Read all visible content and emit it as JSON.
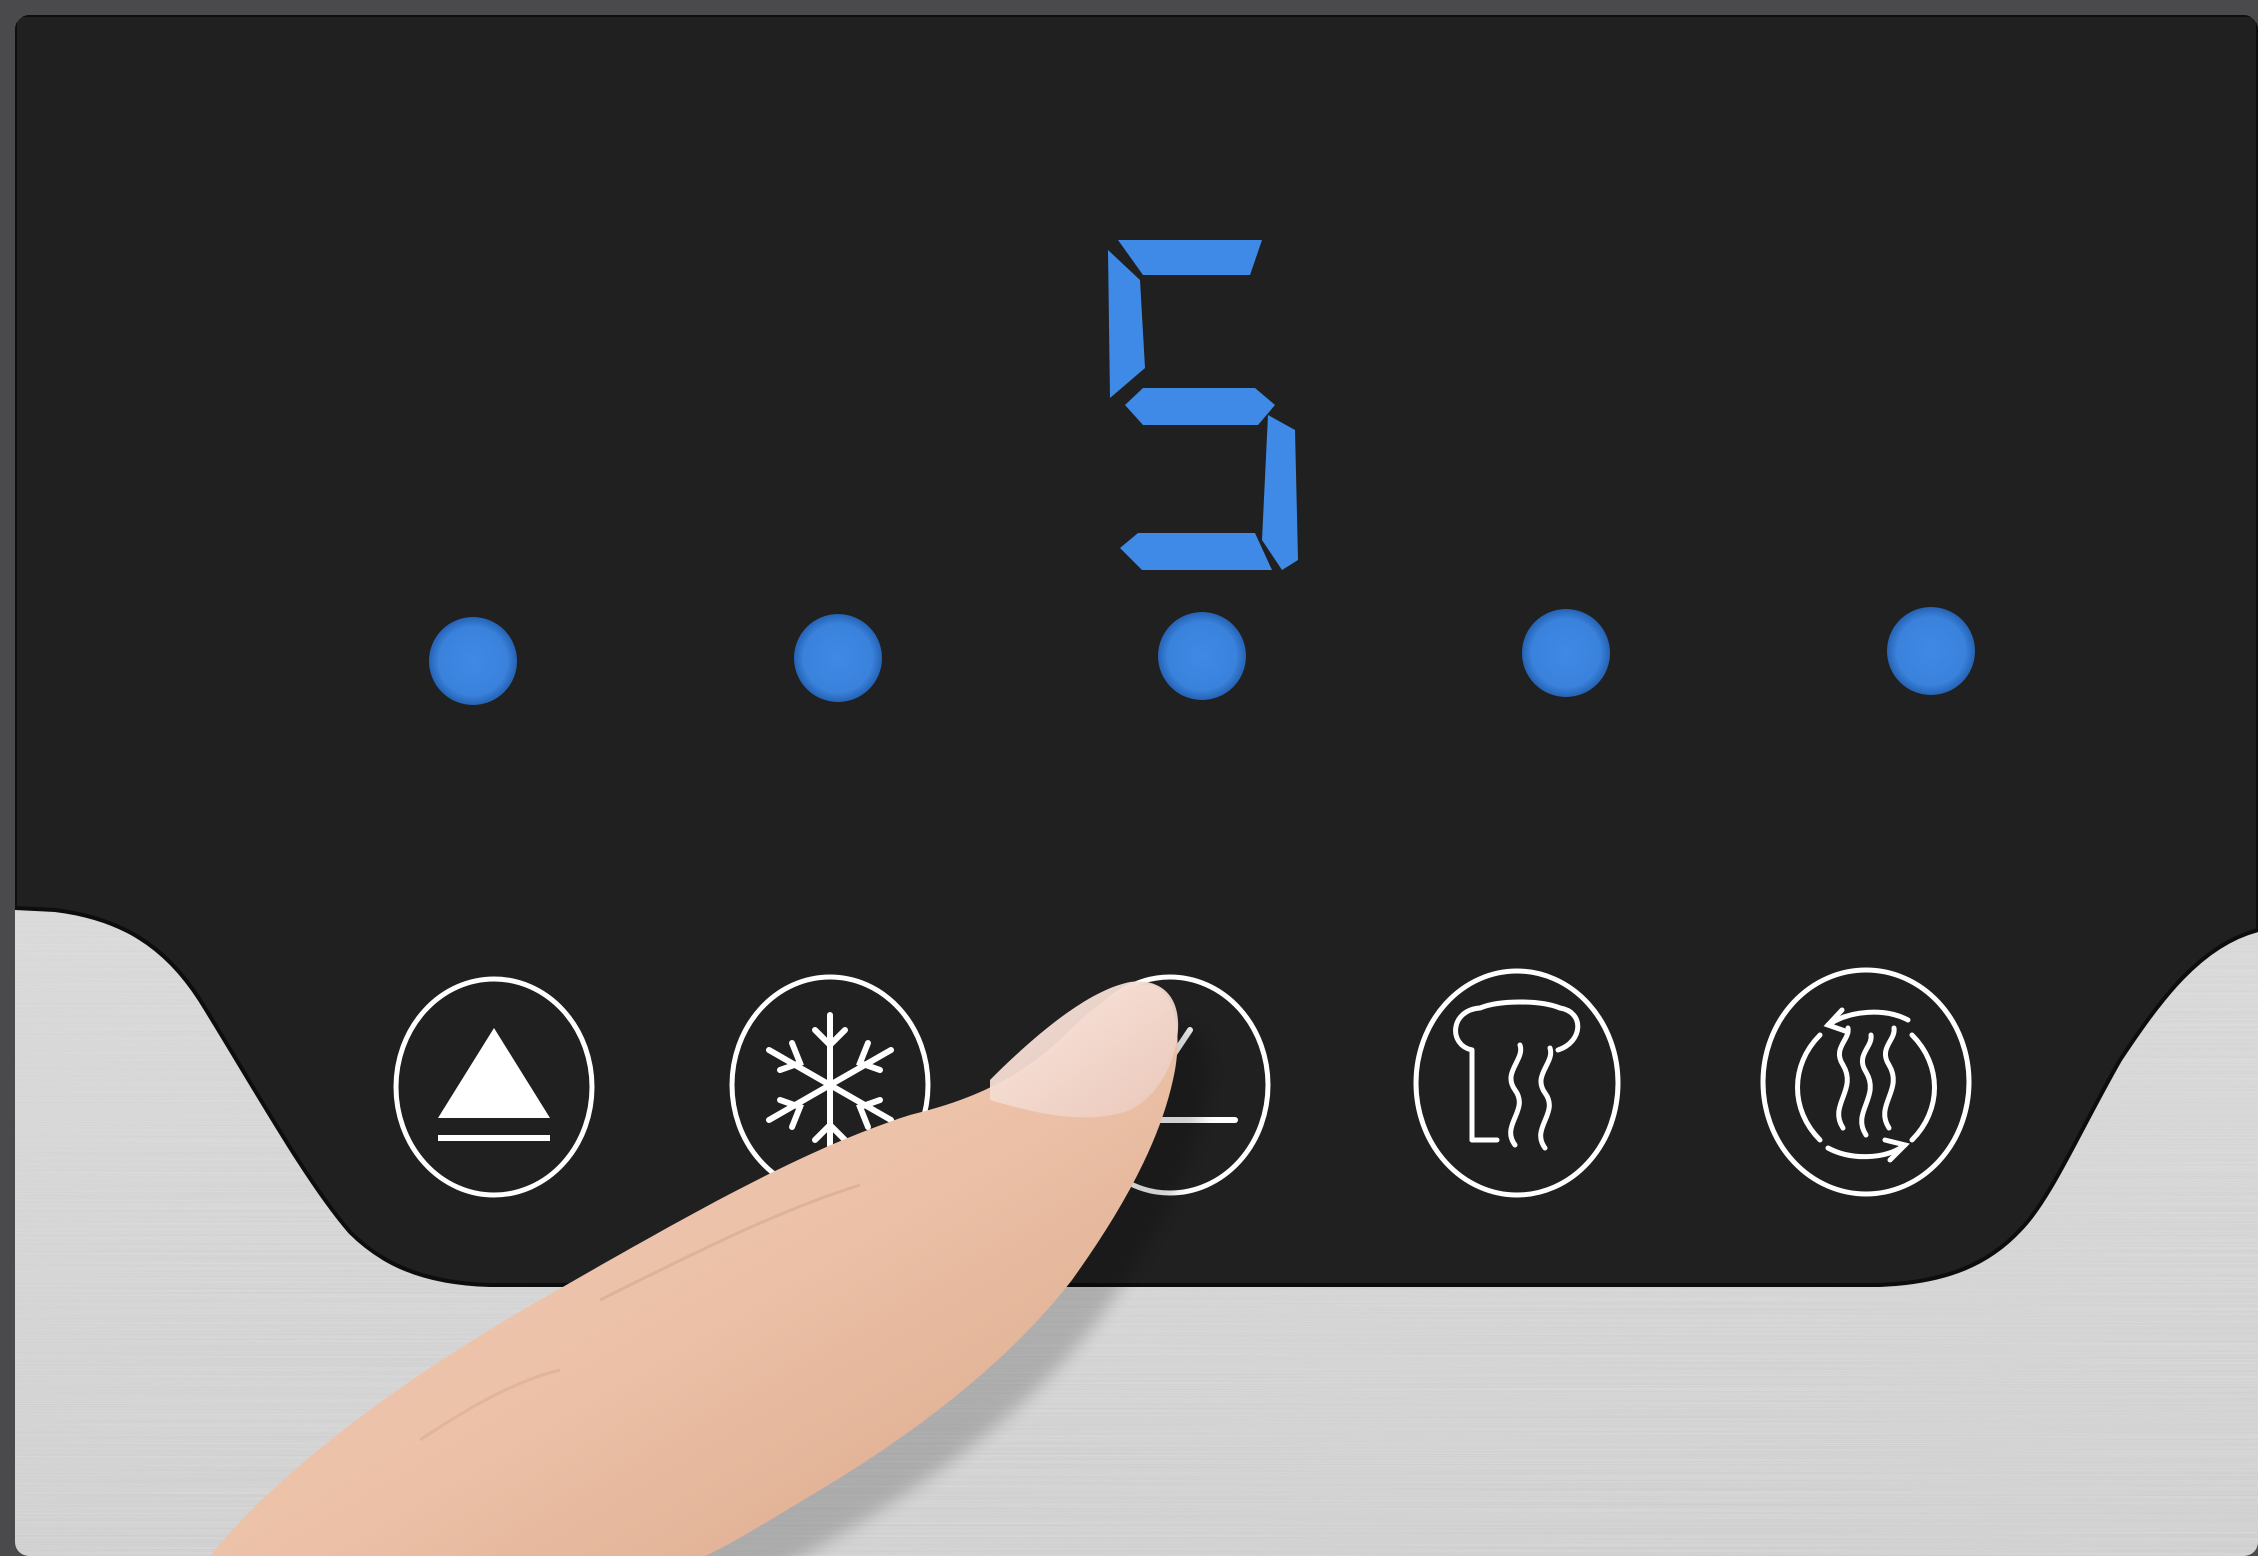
{
  "display": {
    "digit": "5",
    "digit_color": "#3f8ae6"
  },
  "indicator_lights": {
    "count": 5,
    "color": "#3d86e2",
    "all_lit": true
  },
  "controls": [
    {
      "icon": "eject-icon"
    },
    {
      "icon": "defrost-icon"
    },
    {
      "icon": "cancel-icon"
    },
    {
      "icon": "toast-icon"
    },
    {
      "icon": "reheat-icon"
    }
  ],
  "colors": {
    "panel": "#202021",
    "steel": "#d4d4d4",
    "icon_line": "#ffffff",
    "skin": "#edc5ad"
  }
}
